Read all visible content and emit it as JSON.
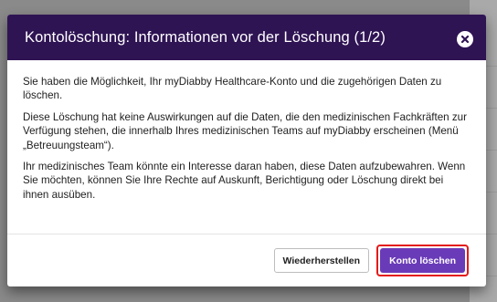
{
  "modal": {
    "title": "Kontolöschung: Informationen vor der Löschung (1/2)",
    "close_icon": "close-circle-icon",
    "paragraphs": [
      "Sie haben die Möglichkeit, Ihr myDiabby Healthcare-Konto und die zugehörigen Daten zu löschen.",
      "Diese Löschung hat keine Auswirkungen auf die Daten, die den medizinischen Fachkräften zur Verfügung stehen, die innerhalb Ihres medizinischen Teams auf myDiabby erscheinen (Menü „Betreuungsteam“).",
      "Ihr medizinisches Team könnte ein Interesse daran haben, diese Daten aufzubewahren. Wenn Sie möchten, können Sie Ihre Rechte auf Auskunft, Berichtigung oder Löschung direkt bei ihnen ausüben."
    ],
    "buttons": {
      "restore_label": "Wiederherstellen",
      "delete_label": "Konto löschen"
    }
  },
  "colors": {
    "header_bg": "#2f1454",
    "primary_button": "#6a3bb8",
    "highlight_border": "#e41a1a"
  }
}
